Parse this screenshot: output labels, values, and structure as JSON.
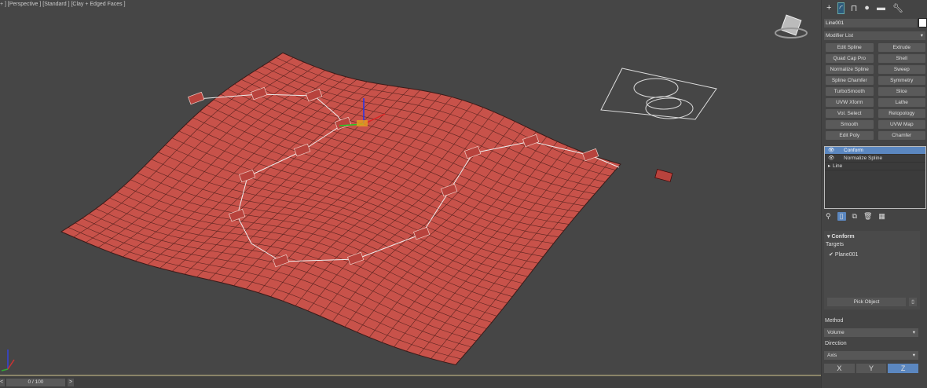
{
  "viewport": {
    "label": "+ ] [Perspective ] [Standard ] [Clay + Edged Faces ]",
    "plane_color": "#c8524a"
  },
  "panel": {
    "tabs": [
      "create",
      "modify",
      "hierarchy",
      "motion",
      "display",
      "utilities"
    ],
    "object_name": "Line001",
    "modifier_list": "Modifier List",
    "modifiers": [
      "Edit Spline",
      "Extrude",
      "Quad Cap Pro",
      "Shell",
      "Normalize Spline",
      "Sweep",
      "Spline Chamfer",
      "Symmetry",
      "TurboSmooth",
      "Slice",
      "UVW Xform",
      "Lathe",
      "Vol. Select",
      "Retopology",
      "Smooth",
      "UVW Map",
      "Edit Poly",
      "Chamfer"
    ],
    "stack": [
      {
        "label": "Conform",
        "selected": true
      },
      {
        "label": "Normalize Spline"
      },
      {
        "label": "Line"
      }
    ],
    "rollout": {
      "title": "Conform",
      "targets_label": "Targets",
      "target": "Plane001",
      "pick": "Pick Object",
      "method_label": "Method",
      "method": "Volume",
      "direction_label": "Direction",
      "direction": "Axis",
      "axes": [
        "X",
        "Y",
        "Z"
      ],
      "active_axis": "Z"
    }
  },
  "timeline": {
    "frame": "0 / 100",
    "prev": "<",
    "next": ">"
  },
  "accent": "#5b87c0"
}
